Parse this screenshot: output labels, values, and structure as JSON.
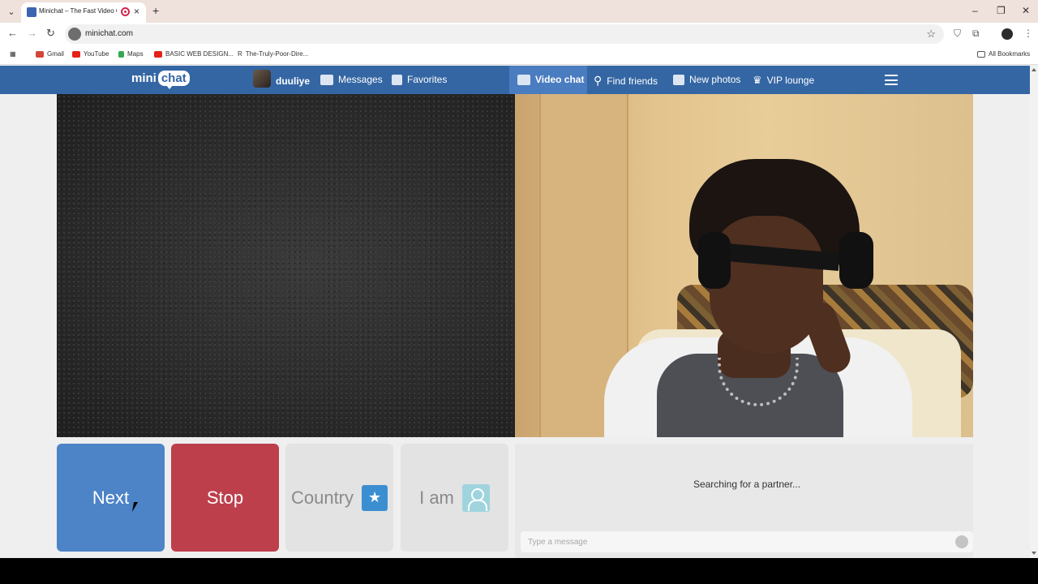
{
  "browser": {
    "tab_title": "Minichat – The Fast Video C",
    "url": "minichat.com",
    "bookmarks": [
      "Gmail",
      "YouTube",
      "Maps",
      "BASIC WEB DESIGN...",
      "The-Truly-Poor-Dire...",
      "All Bookmarks"
    ]
  },
  "sitenav": {
    "logo_left": "mini",
    "logo_right": "chat",
    "username": "duuliye",
    "messages": "Messages",
    "favorites": "Favorites",
    "video_chat": "Video chat",
    "find_friends": "Find friends",
    "new_photos": "New photos",
    "vip_lounge": "VIP lounge"
  },
  "controls": {
    "next": "Next",
    "stop": "Stop",
    "country": "Country",
    "iam": "I am"
  },
  "chat": {
    "status": "Searching for a partner...",
    "placeholder": "Type a message"
  },
  "colors": {
    "nav": "#3466a4",
    "next": "#4d83c7",
    "stop": "#bd3f4c",
    "star_badge": "#3b8fd1"
  }
}
